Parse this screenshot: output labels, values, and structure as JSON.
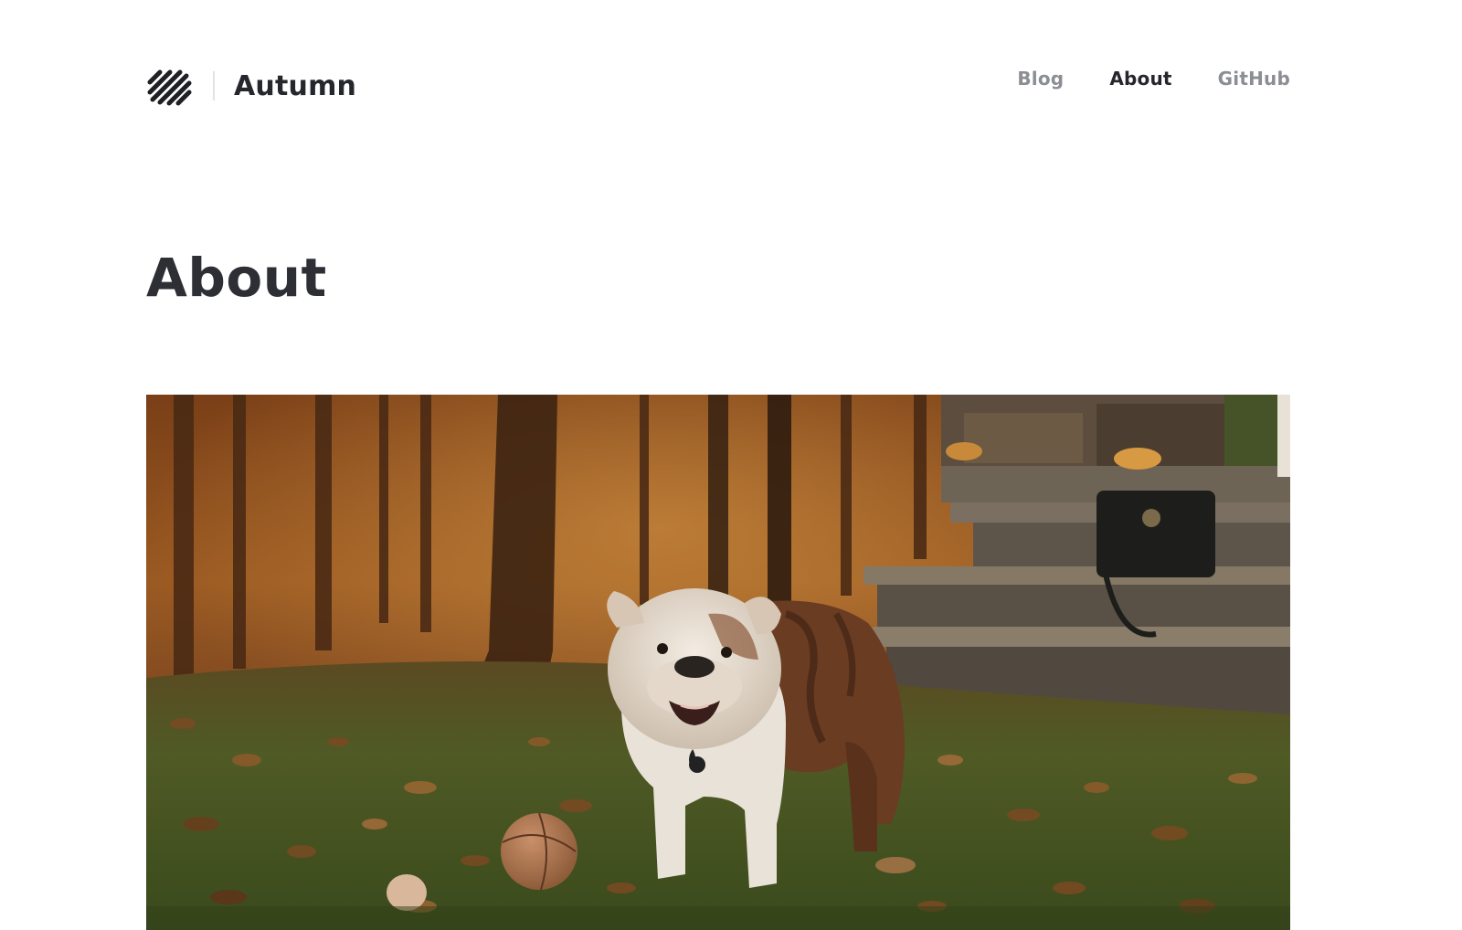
{
  "site": {
    "brand_name": "Autumn"
  },
  "nav": {
    "items": [
      {
        "label": "Blog",
        "active": false
      },
      {
        "label": "About",
        "active": true
      },
      {
        "label": "GitHub",
        "active": false
      }
    ]
  },
  "page": {
    "title": "About"
  },
  "hero": {
    "subject": "bulldog standing on autumn leaves with a ball, trees and stone steps"
  },
  "colors": {
    "text_dark": "#25272c",
    "nav_muted": "#8b8e93",
    "divider": "#e2e2e2",
    "background": "#ffffff"
  }
}
